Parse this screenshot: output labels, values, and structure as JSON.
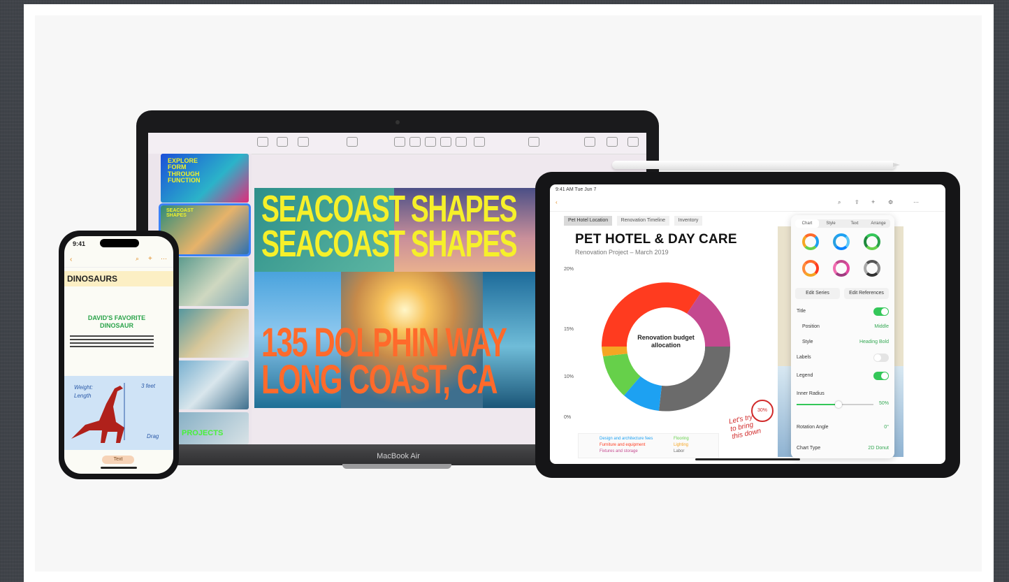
{
  "macbook": {
    "label": "MacBook Air",
    "slide": {
      "headline_top": "SEACOAST SHAPES\nSEACOAST SHAPES",
      "headline_bottom": "135 DOLPHIN WAY\nLONG COAST, CA"
    },
    "thumbnails": [
      {
        "text": "EXPLORE FORM THROUGH FUNCTION"
      },
      {
        "text": "SEACOAST SHAPES"
      },
      {
        "text": ""
      },
      {
        "text": ""
      },
      {
        "text": ""
      },
      {
        "text": "PROJECTS"
      }
    ]
  },
  "iphone": {
    "title": "DINOSAURS",
    "green_heading": "DAVID'S FAVORITE DINOSAUR",
    "hand_notes": [
      "Weight:",
      "3 feet",
      "Drag",
      "Length"
    ],
    "pill": "Text"
  },
  "ipad": {
    "title": "PET HOTEL & DAY CARE",
    "subtitle": "Renovation Project – March 2019",
    "tabs": [
      "Pet Hotel Location",
      "Renovation Timeline",
      "Inventory"
    ],
    "donut_center_label": "Renovation budget allocation",
    "y_ticks": [
      "20%",
      "15%",
      "10%",
      "0%"
    ],
    "handwritten_note": "Let's try\nto bring\nthis down",
    "circled_value": "30%",
    "legend": [
      "Design and architecture fees",
      "Furniture and equipment",
      "Fixtures and storage",
      "Flooring",
      "Lighting",
      "Labor"
    ],
    "inspector": {
      "tabs": [
        "Chart",
        "Style",
        "Text",
        "Arrange"
      ],
      "edit_series": "Edit Series",
      "edit_references": "Edit References",
      "rows": [
        {
          "label": "Title",
          "toggle": "on"
        },
        {
          "label": "Position",
          "value": "Middle"
        },
        {
          "label": "Style",
          "value": "Heading Bold"
        },
        {
          "label": "Labels",
          "toggle": "off"
        },
        {
          "label": "Legend",
          "toggle": "on"
        },
        {
          "label": "Inner Radius",
          "value": "50%"
        },
        {
          "label": "Rotation Angle",
          "value": "0°"
        },
        {
          "label": "Chart Type",
          "value": "2D Donut"
        }
      ],
      "inner_radius_fraction": 0.5
    }
  },
  "colors": {
    "donut": [
      "#ff3b1f",
      "#c4498f",
      "#6b6b6b",
      "#1da1f2",
      "#66d04a",
      "#f5a623"
    ],
    "accent_green": "#34c759"
  }
}
